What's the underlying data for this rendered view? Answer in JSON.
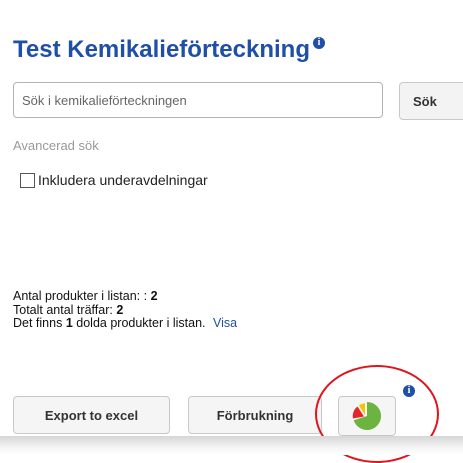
{
  "header": {
    "title": "Test Kemikalieförteckning",
    "info_icon": "info-icon",
    "info_glyph": "i"
  },
  "search": {
    "placeholder": "Sök i kemikalieförteckningen",
    "value": "",
    "button_label": "Sök",
    "advanced_label": "Avancerad sök"
  },
  "options": {
    "include_subdivisions_label": "Inkludera underavdelningar",
    "include_subdivisions_checked": false
  },
  "stats": {
    "products_label": "Antal produkter i listan: :",
    "products_value": "2",
    "hits_label": "Totalt antal träffar:",
    "hits_value": "2",
    "hidden_prefix": "Det finns",
    "hidden_value": "1",
    "hidden_suffix": "dolda produkter i listan.",
    "show_link": "Visa"
  },
  "actions": {
    "export_label": "Export to excel",
    "consumption_label": "Förbrukning",
    "chart_icon": "pie-chart-icon"
  },
  "colors": {
    "brand": "#1f4fa6",
    "highlight": "#e0141e",
    "pie_green": "#6cb33f",
    "pie_red": "#e3262e",
    "pie_yellow": "#f2c500"
  }
}
